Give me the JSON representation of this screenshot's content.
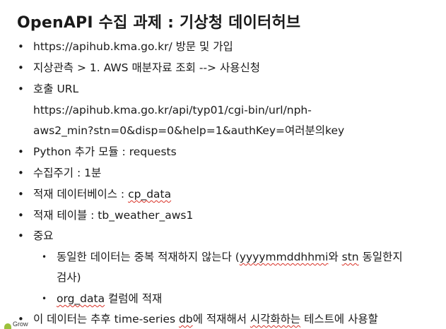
{
  "title": "OpenAPI 수집 과제 : 기상청 데이터허브",
  "bullets": {
    "b1": "https://apihub.kma.go.kr/ 방문 및 가입",
    "b2": "지상관측 > 1. AWS 매분자료 조회 --> 사용신청",
    "b3": "호출 URL",
    "b3_line2": "https://apihub.kma.go.kr/api/typ01/cgi-bin/url/nph-",
    "b3_line3": "aws2_min?stn=0&disp=0&help=1&authKey=여러분의key",
    "b4": "Python 추가 모듈 : requests",
    "b5": "수집주기 : 1분",
    "b6_prefix": "적재 데이터베이스 : ",
    "b6_value": "cp_data",
    "b7": "적재 테이블 : tb_weather_aws1",
    "b8": "중요",
    "b8_sub1_a": "동일한 데이터는 중복 적재하지 않는다 (",
    "b8_sub1_b": "yyyymmddhhmi",
    "b8_sub1_c": "와 ",
    "b8_sub1_d": "stn",
    "b8_sub1_e": " 동일한지",
    "b8_sub1_line2": "검사)",
    "b8_sub2_a": "org_data",
    "b8_sub2_b": " 컬럼에 적재",
    "b9_a": "이 데이터는 추후 time-series ",
    "b9_b": "db",
    "b9_c": "에 적재해서 ",
    "b9_d": "시각화하는",
    "b9_e": " 테스트에 사용할"
  },
  "symbols": {
    "bullet": "•",
    "sub_bullet": "•"
  },
  "logo": {
    "text": "Growth"
  }
}
